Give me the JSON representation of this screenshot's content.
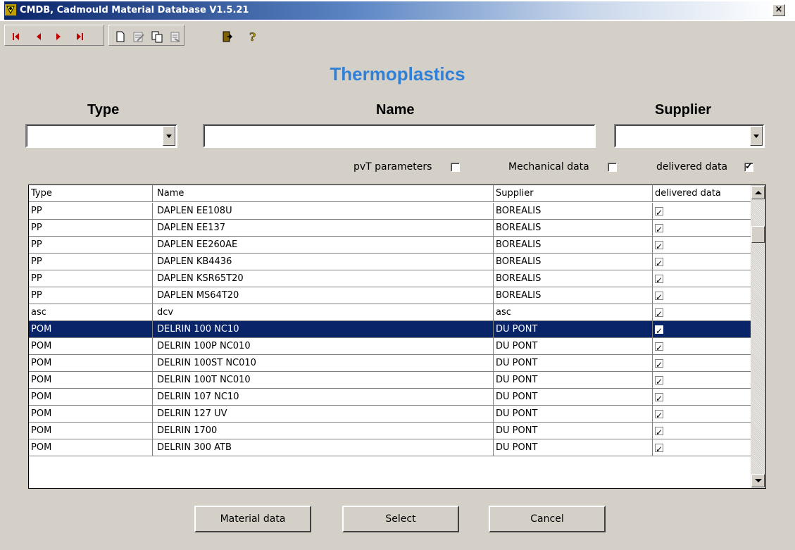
{
  "window": {
    "title": "CMDB, Cadmould Material Database V1.5.21",
    "close_label": "×"
  },
  "toolbar": {
    "buttons": [
      {
        "icon": "first-record-icon"
      },
      {
        "icon": "previous-record-icon"
      },
      {
        "icon": "next-record-icon"
      },
      {
        "icon": "last-record-icon"
      },
      {
        "icon": "new-document-icon"
      },
      {
        "icon": "edit-document-icon"
      },
      {
        "icon": "copy-icon"
      },
      {
        "icon": "delete-icon"
      },
      {
        "icon": "exit-door-icon"
      },
      {
        "icon": "help-icon"
      }
    ]
  },
  "main": {
    "heading": "Thermoplastics",
    "filters": {
      "type_label": "Type",
      "name_label": "Name",
      "supplier_label": "Supplier",
      "type_value": "",
      "name_value": "",
      "supplier_value": ""
    },
    "checkboxes": {
      "pvt_label": "pvT parameters",
      "pvt_checked": false,
      "mechanical_label": "Mechanical data",
      "mechanical_checked": false,
      "delivered_label": "delivered data",
      "delivered_checked": true
    }
  },
  "table": {
    "columns": [
      "Type",
      "Name",
      "Supplier",
      "delivered data"
    ],
    "rows": [
      {
        "type": "PP",
        "name": "DAPLEN EE108U",
        "supplier": "BOREALIS",
        "delivered": true
      },
      {
        "type": "PP",
        "name": "DAPLEN EE137",
        "supplier": "BOREALIS",
        "delivered": true
      },
      {
        "type": "PP",
        "name": "DAPLEN EE260AE",
        "supplier": "BOREALIS",
        "delivered": true
      },
      {
        "type": "PP",
        "name": "DAPLEN KB4436",
        "supplier": "BOREALIS",
        "delivered": true
      },
      {
        "type": "PP",
        "name": "DAPLEN KSR65T20",
        "supplier": "BOREALIS",
        "delivered": true
      },
      {
        "type": "PP",
        "name": "DAPLEN MS64T20",
        "supplier": "BOREALIS",
        "delivered": true
      },
      {
        "type": "asc",
        "name": "dcv",
        "supplier": "asc",
        "delivered": true
      },
      {
        "type": "POM",
        "name": "DELRIN 100 NC10",
        "supplier": "DU PONT",
        "delivered": true,
        "selected": true
      },
      {
        "type": "POM",
        "name": "DELRIN 100P NC010",
        "supplier": "DU PONT",
        "delivered": true
      },
      {
        "type": "POM",
        "name": "DELRIN 100ST NC010",
        "supplier": "DU PONT",
        "delivered": true
      },
      {
        "type": "POM",
        "name": "DELRIN 100T NC010",
        "supplier": "DU PONT",
        "delivered": true
      },
      {
        "type": "POM",
        "name": "DELRIN 107 NC10",
        "supplier": "DU PONT",
        "delivered": true
      },
      {
        "type": "POM",
        "name": "DELRIN 127 UV",
        "supplier": "DU PONT",
        "delivered": true
      },
      {
        "type": "POM",
        "name": "DELRIN 1700",
        "supplier": "DU PONT",
        "delivered": true
      },
      {
        "type": "POM",
        "name": "DELRIN 300 ATB",
        "supplier": "DU PONT",
        "delivered": true
      }
    ]
  },
  "buttons": {
    "material_data": "Material data",
    "select": "Select",
    "cancel": "Cancel"
  },
  "colors": {
    "window_bg": "#d4d0c8",
    "heading": "#2f80d6",
    "selection": "#0a246a",
    "title_bar": "#0a246a"
  }
}
